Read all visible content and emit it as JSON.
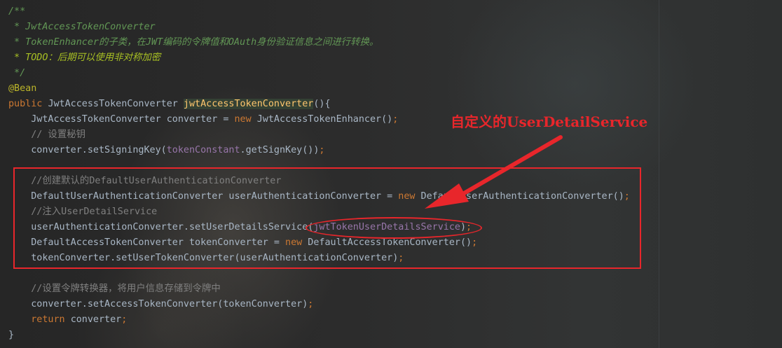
{
  "editor": {
    "lines": [
      [
        {
          "t": "/**",
          "c": "doc"
        }
      ],
      [
        {
          "t": " * JwtAccessTokenConverter",
          "c": "doc"
        }
      ],
      [
        {
          "t": " * TokenEnhancer的子类，在JWT编码的令牌值和OAuth身份验证信息之间进行转换。",
          "c": "doc"
        }
      ],
      [
        {
          "t": " * TODO：后期可以使用非对称加密",
          "c": "todo"
        }
      ],
      [
        {
          "t": " */",
          "c": "doc"
        }
      ],
      [
        {
          "t": "@Bean",
          "c": "anno"
        }
      ],
      [
        {
          "t": "public ",
          "c": "kw"
        },
        {
          "t": "JwtAccessTokenConverter ",
          "c": ""
        },
        {
          "t": "jwtAccessTokenConverter",
          "c": "fn hl"
        },
        {
          "t": "(){",
          "c": ""
        }
      ],
      [
        {
          "t": "    JwtAccessTokenConverter converter = ",
          "c": ""
        },
        {
          "t": "new ",
          "c": "kw"
        },
        {
          "t": "JwtAccessTokenEnhancer()",
          "c": ""
        },
        {
          "t": ";",
          "c": "sem"
        }
      ],
      [
        {
          "t": "    // 设置秘钥",
          "c": "cmt"
        }
      ],
      [
        {
          "t": "    converter.setSigningKey(",
          "c": ""
        },
        {
          "t": "tokenConstant",
          "c": "fld"
        },
        {
          "t": ".getSignKey())",
          "c": ""
        },
        {
          "t": ";",
          "c": "sem"
        }
      ],
      [
        {
          "t": "",
          "c": ""
        }
      ],
      [
        {
          "t": "    //创建默认的DefaultUserAuthenticationConverter",
          "c": "cmt"
        }
      ],
      [
        {
          "t": "    DefaultUserAuthenticationConverter userAuthenticationConverter = ",
          "c": ""
        },
        {
          "t": "new ",
          "c": "kw"
        },
        {
          "t": "DefaultUserAuthenticationConverter()",
          "c": ""
        },
        {
          "t": ";",
          "c": "sem"
        }
      ],
      [
        {
          "t": "    //注入UserDetailService",
          "c": "cmt"
        }
      ],
      [
        {
          "t": "    userAuthenticationConverter.setUserDetailsService(",
          "c": ""
        },
        {
          "t": "jwtTokenUserDetailsService",
          "c": "fld"
        },
        {
          "t": ")",
          "c": ""
        },
        {
          "t": ";",
          "c": "sem"
        }
      ],
      [
        {
          "t": "    DefaultAccessTokenConverter tokenConverter = ",
          "c": ""
        },
        {
          "t": "new ",
          "c": "kw"
        },
        {
          "t": "DefaultAccessTokenConverter()",
          "c": ""
        },
        {
          "t": ";",
          "c": "sem"
        }
      ],
      [
        {
          "t": "    tokenConverter.setUserTokenConverter(userAuthenticationConverter)",
          "c": ""
        },
        {
          "t": ";",
          "c": "sem"
        }
      ],
      [
        {
          "t": "",
          "c": ""
        }
      ],
      [
        {
          "t": "    //设置令牌转换器，将用户信息存储到令牌中",
          "c": "cmt"
        }
      ],
      [
        {
          "t": "    converter.setAccessTokenConverter(tokenConverter)",
          "c": ""
        },
        {
          "t": ";",
          "c": "sem"
        }
      ],
      [
        {
          "t": "    ",
          "c": ""
        },
        {
          "t": "return ",
          "c": "kw"
        },
        {
          "t": "converter",
          "c": ""
        },
        {
          "t": ";",
          "c": "sem"
        }
      ],
      [
        {
          "t": "}",
          "c": ""
        }
      ]
    ]
  },
  "annotation": {
    "callout_text": "自定义的UserDetailService",
    "color": "#e8262b"
  }
}
